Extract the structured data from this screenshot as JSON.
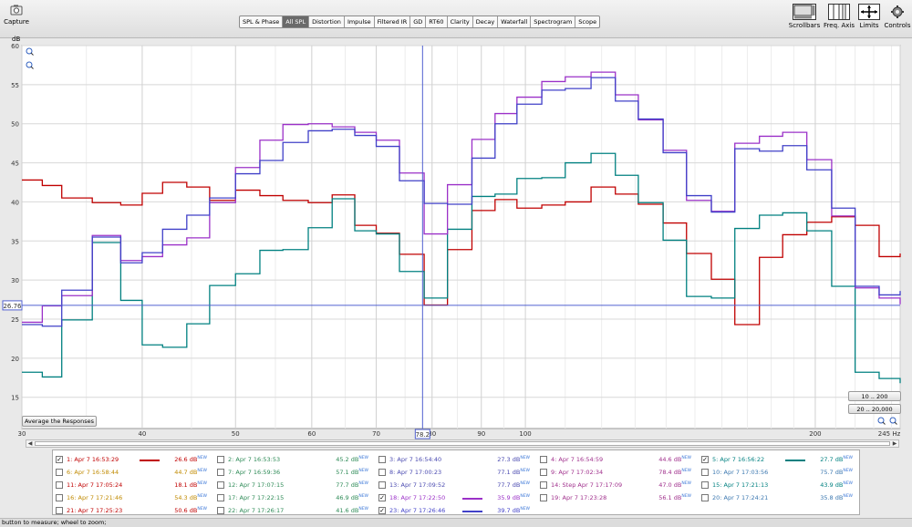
{
  "toolbar": {
    "capture_label": "Capture",
    "tabs": [
      "SPL & Phase",
      "All SPL",
      "Distortion",
      "Impulse",
      "Filtered IR",
      "GD",
      "RT60",
      "Clarity",
      "Decay",
      "Waterfall",
      "Spectrogram",
      "Scope"
    ],
    "active_tab": "All SPL",
    "right_buttons": [
      "Scrollbars",
      "Freq. Axis",
      "Limits",
      "Controls"
    ]
  },
  "plot": {
    "y_unit": "dB",
    "cursor_y_readout": "26.76",
    "cursor_x_readout": "78.2",
    "x_unit": "Hz",
    "range_buttons": [
      "10 .. 200",
      "20 .. 20,000"
    ],
    "average_button": "Average the Responses"
  },
  "chart_data": {
    "type": "line",
    "ylabel": "dB",
    "xlabel": "",
    "x_scale": "log",
    "xlim": [
      30,
      245
    ],
    "ylim": [
      11,
      60
    ],
    "x_ticks": [
      "30",
      "40",
      "50",
      "60",
      "70",
      "80",
      "90",
      "100",
      "200",
      "245 Hz"
    ],
    "y_ticks": [
      "60",
      "55",
      "50",
      "45",
      "40",
      "35",
      "30",
      "25",
      "20",
      "15"
    ],
    "grid": true,
    "cursor": {
      "x": 78.2,
      "y": 26.76
    },
    "series": [
      {
        "name": "1: Apr 7 16:53:29",
        "color": "#c00000",
        "x": [
          30,
          31.5,
          33,
          35.5,
          38,
          40,
          42,
          44.5,
          47,
          50,
          53,
          56,
          59.5,
          63,
          66.5,
          70,
          74,
          78.5,
          83,
          88,
          93,
          98,
          104,
          110,
          117,
          124,
          131,
          139,
          147,
          156,
          165,
          175,
          185,
          196,
          208,
          220,
          233,
          245
        ],
        "y": [
          42.8,
          42.1,
          40.5,
          39.9,
          39.6,
          41.1,
          42.5,
          41.9,
          40.2,
          41.5,
          40.8,
          40.2,
          39.9,
          40.9,
          37.0,
          36.0,
          33.3,
          26.8,
          33.9,
          38.9,
          40.3,
          39.2,
          39.6,
          40.0,
          41.9,
          41.0,
          39.7,
          37.3,
          33.4,
          30.1,
          24.3,
          32.9,
          35.8,
          37.4,
          38.1,
          37.0,
          33.0,
          33.4
        ]
      },
      {
        "name": "5: Apr 7 16:56:22",
        "color": "#008080",
        "x": [
          30,
          31.5,
          33,
          35.5,
          38,
          40,
          42,
          44.5,
          47,
          50,
          53,
          56,
          59.5,
          63,
          66.5,
          70,
          74,
          78.5,
          83,
          88,
          93,
          98,
          104,
          110,
          117,
          124,
          131,
          139,
          147,
          156,
          165,
          175,
          185,
          196,
          208,
          220,
          233,
          245
        ],
        "y": [
          18.2,
          17.6,
          24.9,
          34.8,
          27.4,
          21.7,
          21.4,
          24.4,
          29.3,
          30.8,
          33.8,
          33.9,
          36.7,
          40.4,
          36.3,
          35.9,
          31.1,
          27.7,
          36.5,
          40.7,
          41.0,
          43.0,
          43.1,
          45.0,
          46.2,
          43.4,
          39.9,
          35.1,
          27.9,
          27.7,
          36.6,
          38.3,
          38.6,
          36.3,
          29.2,
          18.2,
          17.4,
          16.8
        ]
      },
      {
        "name": "18: Apr 7 17:22:50",
        "color": "#9b30c8",
        "x": [
          30,
          31.5,
          33,
          35.5,
          38,
          40,
          42,
          44.5,
          47,
          50,
          53,
          56,
          59.5,
          63,
          66.5,
          70,
          74,
          78.5,
          83,
          88,
          93,
          98,
          104,
          110,
          117,
          124,
          131,
          139,
          147,
          156,
          165,
          175,
          185,
          196,
          208,
          220,
          233,
          245
        ],
        "y": [
          24.6,
          26.7,
          28.0,
          35.7,
          32.5,
          33.0,
          34.5,
          35.4,
          39.9,
          44.4,
          47.9,
          49.9,
          50.0,
          49.6,
          48.9,
          47.9,
          43.7,
          35.9,
          42.2,
          48.0,
          51.3,
          53.4,
          55.4,
          56.0,
          56.6,
          53.7,
          50.5,
          46.6,
          40.2,
          38.8,
          47.5,
          48.4,
          48.9,
          45.4,
          38.2,
          29.0,
          27.7,
          26.9
        ]
      },
      {
        "name": "23: Apr 7 17:26:46",
        "color": "#4040c8",
        "x": [
          30,
          31.5,
          33,
          35.5,
          38,
          40,
          42,
          44.5,
          47,
          50,
          53,
          56,
          59.5,
          63,
          66.5,
          70,
          74,
          78.5,
          83,
          88,
          93,
          98,
          104,
          110,
          117,
          124,
          131,
          139,
          147,
          156,
          165,
          175,
          185,
          196,
          208,
          220,
          233,
          245
        ],
        "y": [
          24.3,
          24.1,
          28.7,
          35.5,
          32.2,
          33.5,
          36.5,
          38.3,
          40.5,
          43.6,
          45.3,
          47.6,
          49.1,
          49.3,
          48.5,
          47.1,
          42.7,
          39.8,
          39.7,
          45.6,
          50.0,
          52.5,
          54.3,
          54.5,
          55.9,
          52.9,
          50.6,
          46.3,
          40.8,
          38.7,
          46.8,
          46.5,
          47.2,
          44.1,
          39.2,
          29.2,
          28.1,
          28.6
        ]
      }
    ]
  },
  "legend": {
    "items": [
      {
        "label": "1: Apr 7 16:53:29",
        "value": "26.6 dB",
        "badge": "NEW",
        "checked": true,
        "color": "#c00000",
        "line": true
      },
      {
        "label": "2: Apr 7 16:53:53",
        "value": "45.2 dB",
        "badge": "NEW",
        "checked": false,
        "color": "#2e8b57",
        "line": false
      },
      {
        "label": "3: Apr 7 16:54:40",
        "value": "27.3 dB",
        "badge": "NEW",
        "checked": false,
        "color": "#4a4ab0",
        "line": false
      },
      {
        "label": "4: Apr 7 16:54:59",
        "value": "44.6 dB",
        "badge": "NEW",
        "checked": false,
        "color": "#a0308c",
        "line": false
      },
      {
        "label": "5: Apr 7 16:56:22",
        "value": "27.7 dB",
        "badge": "NEW",
        "checked": true,
        "color": "#008080",
        "line": true
      },
      {
        "label": "6: Apr 7 16:58:44",
        "value": "44.7 dB",
        "badge": "NEW",
        "checked": false,
        "color": "#c08a00",
        "line": false
      },
      {
        "label": "7: Apr 7 16:59:36",
        "value": "57.1 dB",
        "badge": "NEW",
        "checked": false,
        "color": "#2e8b57",
        "line": false
      },
      {
        "label": "8: Apr 7 17:00:23",
        "value": "77.1 dB",
        "badge": "NEW",
        "checked": false,
        "color": "#4a4ab0",
        "line": false
      },
      {
        "label": "9: Apr 7 17:02:34",
        "value": "78.4 dB",
        "badge": "NEW",
        "checked": false,
        "color": "#a0308c",
        "line": false
      },
      {
        "label": "10: Apr 7 17:03:56",
        "value": "75.7 dB",
        "badge": "NEW",
        "checked": false,
        "color": "#3c78b0",
        "line": false
      },
      {
        "label": "11: Apr 7 17:05:24",
        "value": "18.1 dB",
        "badge": "NEW",
        "checked": false,
        "color": "#c00000",
        "line": false
      },
      {
        "label": "12: Apr 7 17:07:15",
        "value": "77.7 dB",
        "badge": "NEW",
        "checked": false,
        "color": "#2e8b57",
        "line": false
      },
      {
        "label": "13: Apr 7 17:09:52",
        "value": "77.7 dB",
        "badge": "NEW",
        "checked": false,
        "color": "#4a4ab0",
        "line": false
      },
      {
        "label": "14: Step Apr 7 17:17:09",
        "value": "47.0 dB",
        "badge": "NEW",
        "checked": false,
        "color": "#a0308c",
        "line": false
      },
      {
        "label": "15: Apr 7 17:21:13",
        "value": "43.9 dB",
        "badge": "NEW",
        "checked": false,
        "color": "#008080",
        "line": false
      },
      {
        "label": "16: Apr 7 17:21:46",
        "value": "54.3 dB",
        "badge": "NEW",
        "checked": false,
        "color": "#c08a00",
        "line": false
      },
      {
        "label": "17: Apr 7 17:22:15",
        "value": "46.9 dB",
        "badge": "NEW",
        "checked": false,
        "color": "#2e8b57",
        "line": false
      },
      {
        "label": "18: Apr 7 17:22:50",
        "value": "35.9 dB",
        "badge": "NEW",
        "checked": true,
        "color": "#9b30c8",
        "line": true
      },
      {
        "label": "19: Apr 7 17:23:28",
        "value": "56.1 dB",
        "badge": "NEW",
        "checked": false,
        "color": "#a0308c",
        "line": false
      },
      {
        "label": "20: Apr 7 17:24:21",
        "value": "35.8 dB",
        "badge": "NEW",
        "checked": false,
        "color": "#3c78b0",
        "line": false
      },
      {
        "label": "21: Apr 7 17:25:23",
        "value": "50.6 dB",
        "badge": "NEW",
        "checked": false,
        "color": "#c00000",
        "line": false
      },
      {
        "label": "22: Apr 7 17:26:17",
        "value": "41.6 dB",
        "badge": "NEW",
        "checked": false,
        "color": "#2e8b57",
        "line": false
      },
      {
        "label": "23: Apr 7 17:26:46",
        "value": "39.7 dB",
        "badge": "NEW",
        "checked": true,
        "color": "#4040c8",
        "line": true
      }
    ]
  },
  "status": {
    "text": "button to measure; wheel to zoom;"
  }
}
